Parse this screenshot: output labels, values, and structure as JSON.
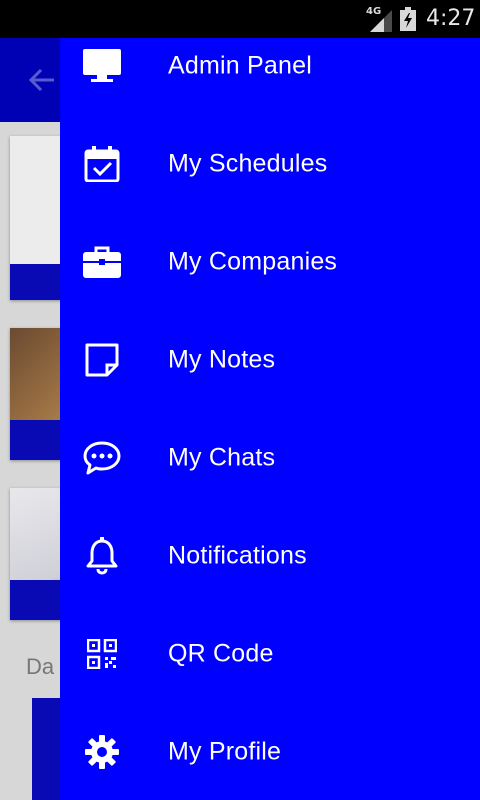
{
  "status_bar": {
    "network": "4G",
    "time": "4:27"
  },
  "background": {
    "date_label_partial": "Da"
  },
  "drawer": {
    "items": [
      {
        "label": "Admin Panel",
        "icon": "monitor-icon"
      },
      {
        "label": "My Schedules",
        "icon": "calendar-check-icon"
      },
      {
        "label": "My Companies",
        "icon": "briefcase-icon"
      },
      {
        "label": "My Notes",
        "icon": "note-icon"
      },
      {
        "label": "My Chats",
        "icon": "chat-bubble-icon"
      },
      {
        "label": "Notifications",
        "icon": "bell-icon"
      },
      {
        "label": "QR Code",
        "icon": "qr-code-icon"
      },
      {
        "label": "My Profile",
        "icon": "gear-icon"
      }
    ]
  },
  "colors": {
    "drawer_background": "#0000ff",
    "toolbar": "#0000b5",
    "text": "#ffffff"
  }
}
